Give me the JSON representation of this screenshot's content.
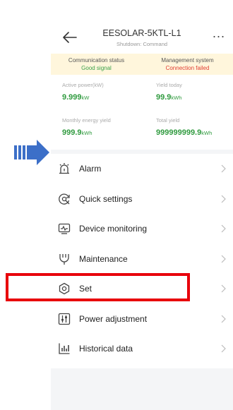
{
  "header": {
    "title": "EESOLAR-5KTL-L1",
    "subtitle": "Shutdown: Command",
    "more_label": "..."
  },
  "status": {
    "communication_label": "Communication status",
    "communication_value": "Good signal",
    "management_label": "Management system",
    "management_value": "Connection failed"
  },
  "stats": {
    "active_power_label": "Active power(kW)",
    "active_power_value": "9.999",
    "active_power_unit": "kW",
    "yield_today_label": "Yield today",
    "yield_today_value": "99.9",
    "yield_today_unit": "kWh",
    "monthly_label": "Monthly energy yield",
    "monthly_value": "999.9",
    "monthly_unit": "kWh",
    "total_label": "Total yield",
    "total_value": "999999999.9",
    "total_unit": "kWh"
  },
  "menu": {
    "items": [
      {
        "label": "Alarm",
        "icon": "alarm-icon"
      },
      {
        "label": "Quick settings",
        "icon": "quick-settings-icon"
      },
      {
        "label": "Device monitoring",
        "icon": "device-monitoring-icon"
      },
      {
        "label": "Maintenance",
        "icon": "maintenance-icon"
      },
      {
        "label": "Set",
        "icon": "set-icon"
      },
      {
        "label": "Power adjustment",
        "icon": "power-adjustment-icon"
      },
      {
        "label": "Historical data",
        "icon": "historical-data-icon"
      }
    ]
  },
  "colors": {
    "arrow": "#3c6fc8",
    "good": "#3aa14a",
    "bad": "#e03c31",
    "value_green": "#2f9a3e",
    "highlight": "#e8000b"
  }
}
